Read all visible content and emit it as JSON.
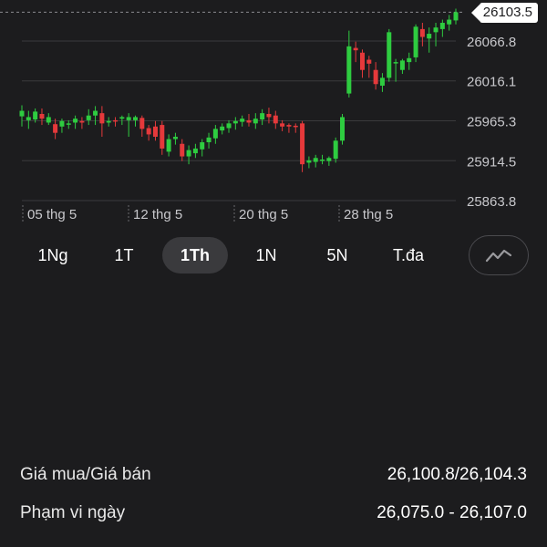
{
  "chart_data": {
    "type": "candlestick",
    "y_ticks": [
      "26066.8",
      "26016.1",
      "25965.3",
      "25914.5",
      "25863.8"
    ],
    "x_ticks": [
      "05 thg 5",
      "12 thg 5",
      "20 thg 5",
      "28 thg 5"
    ],
    "last_price": "26103.5",
    "up_color": "#2ecc40",
    "down_color": "#e5393b",
    "candles": [
      [
        25971,
        25978,
        25958,
        25985
      ],
      [
        25966,
        25970,
        25955,
        25978
      ],
      [
        25967,
        25977,
        25963,
        25981
      ],
      [
        25974,
        25968,
        25960,
        25981
      ],
      [
        25963,
        25970,
        25960,
        25975
      ],
      [
        25961,
        25950,
        25942,
        25968
      ],
      [
        25958,
        25965,
        25950,
        25968
      ],
      [
        25962,
        25962,
        25955,
        25966
      ],
      [
        25963,
        25968,
        25955,
        25972
      ],
      [
        25965,
        25963,
        25955,
        25970
      ],
      [
        25966,
        25972,
        25960,
        25980
      ],
      [
        25972,
        25978,
        25960,
        25984
      ],
      [
        25975,
        25962,
        25945,
        25984
      ],
      [
        25963,
        25965,
        25958,
        25970
      ],
      [
        25966,
        25965,
        25958,
        25970
      ],
      [
        25968,
        25970,
        25960,
        25972
      ],
      [
        25966,
        25970,
        25945,
        25975
      ],
      [
        25966,
        25970,
        25958,
        25972
      ],
      [
        25969,
        25955,
        25945,
        25972
      ],
      [
        25956,
        25948,
        25940,
        25960
      ],
      [
        25958,
        25945,
        25940,
        25965
      ],
      [
        25960,
        25930,
        25922,
        25965
      ],
      [
        25926,
        25942,
        25920,
        25948
      ],
      [
        25942,
        25945,
        25935,
        25950
      ],
      [
        25936,
        25920,
        25914,
        25942
      ],
      [
        25920,
        25928,
        25910,
        25934
      ],
      [
        25924,
        25930,
        25918,
        25936
      ],
      [
        25929,
        25938,
        25920,
        25942
      ],
      [
        25938,
        25944,
        25930,
        25950
      ],
      [
        25943,
        25955,
        25936,
        25960
      ],
      [
        25953,
        25958,
        25948,
        25962
      ],
      [
        25956,
        25962,
        25950,
        25966
      ],
      [
        25962,
        25965,
        25954,
        25970
      ],
      [
        25964,
        25968,
        25958,
        25972
      ],
      [
        25966,
        25963,
        25958,
        25974
      ],
      [
        25962,
        25968,
        25955,
        25975
      ],
      [
        25967,
        25975,
        25960,
        25980
      ],
      [
        25974,
        25970,
        25962,
        25982
      ],
      [
        25972,
        25962,
        25955,
        25978
      ],
      [
        25962,
        25958,
        25952,
        25966
      ],
      [
        25960,
        25958,
        25950,
        25962
      ],
      [
        25959,
        25958,
        25950,
        25962
      ],
      [
        25962,
        25910,
        25900,
        25965
      ],
      [
        25912,
        25915,
        25905,
        25920
      ],
      [
        25913,
        25918,
        25906,
        25922
      ],
      [
        25916,
        25916,
        25910,
        25922
      ],
      [
        25914,
        25918,
        25908,
        25920
      ],
      [
        25917,
        25940,
        25912,
        25944
      ],
      [
        25940,
        25970,
        25935,
        25974
      ],
      [
        26000,
        26060,
        25995,
        26080
      ],
      [
        26058,
        26055,
        26040,
        26066
      ],
      [
        26052,
        26030,
        26020,
        26056
      ],
      [
        26043,
        26038,
        26020,
        26048
      ],
      [
        26030,
        26012,
        26005,
        26040
      ],
      [
        26010,
        26020,
        26002,
        26026
      ],
      [
        26020,
        26078,
        26015,
        26082
      ],
      [
        26040,
        26040,
        26015,
        26044
      ],
      [
        26030,
        26042,
        26025,
        26044
      ],
      [
        26040,
        26045,
        26030,
        26052
      ],
      [
        26046,
        26085,
        26040,
        26088
      ],
      [
        26082,
        26072,
        26060,
        26090
      ],
      [
        26070,
        26076,
        26052,
        26084
      ],
      [
        26078,
        26084,
        26060,
        26090
      ],
      [
        26082,
        26090,
        26072,
        26094
      ],
      [
        26088,
        26094,
        26080,
        26100
      ],
      [
        26093,
        26103.5,
        26088,
        26108
      ]
    ]
  },
  "range_tabs": [
    {
      "label": "1Ng"
    },
    {
      "label": "1T"
    },
    {
      "label": "1Th",
      "active": true
    },
    {
      "label": "1N"
    },
    {
      "label": "5N"
    },
    {
      "label": "T.đa"
    }
  ],
  "chart_type_icon": "line-chart-icon",
  "stats": [
    {
      "label": "Giá mua/Giá bán",
      "value": "26,100.8/26,104.3"
    },
    {
      "label": "Phạm vi ngày",
      "value": "26,075.0 - 26,107.0"
    }
  ]
}
